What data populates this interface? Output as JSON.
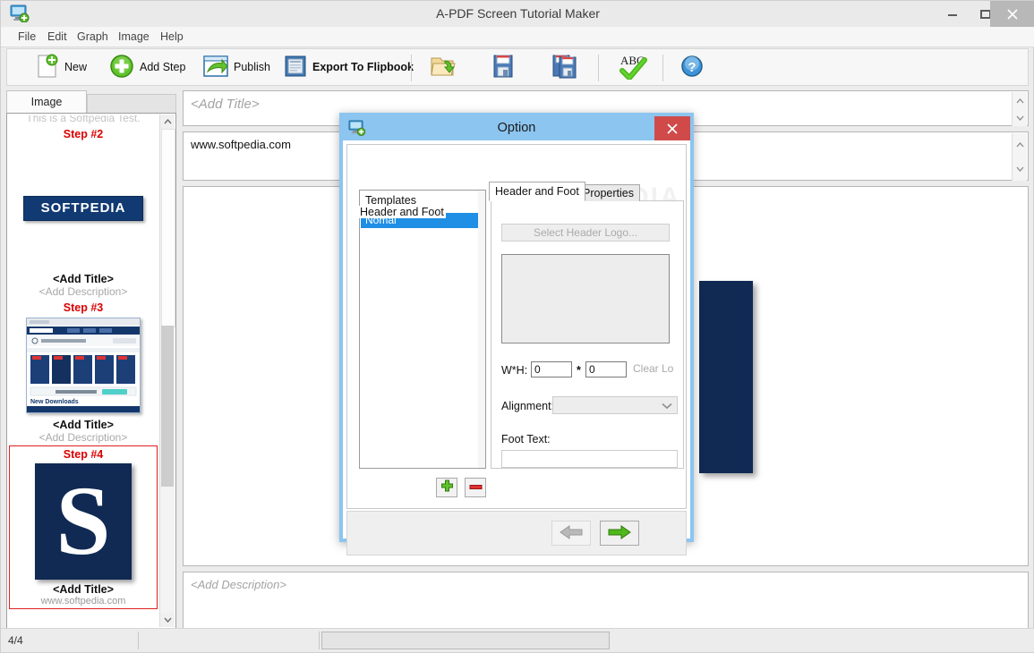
{
  "window": {
    "title": "A-PDF Screen Tutorial Maker",
    "icon": "monitor-add-icon",
    "controls": {
      "minimize": "minimize-icon",
      "maximize": "maximize-icon",
      "close": "close-icon"
    }
  },
  "menubar": {
    "items": [
      "File",
      "Edit",
      "Graph",
      "Image",
      "Help"
    ]
  },
  "toolbar": {
    "buttons": [
      {
        "label": "New",
        "icon": "new-document-icon",
        "bold": false
      },
      {
        "label": "Add Step",
        "icon": "green-plus-circle-icon",
        "bold": false
      },
      {
        "label": "Publish",
        "icon": "publish-window-arrow-icon",
        "bold": false
      },
      {
        "label": "Export To Flipbook",
        "icon": "book-icon",
        "bold": true
      },
      {
        "label": "",
        "icon": "open-folder-icon",
        "bold": false
      },
      {
        "label": "",
        "icon": "save-floppy-icon",
        "bold": false
      },
      {
        "label": "",
        "icon": "save-as-floppy-icon",
        "bold": false
      },
      {
        "label": "",
        "icon": "abc-spellcheck-icon",
        "bold": false
      },
      {
        "label": "",
        "icon": "help-question-icon",
        "bold": false
      }
    ]
  },
  "sidebar": {
    "tab_label": "Image",
    "thumbnails": [
      {
        "step": "",
        "top_text": "This is a Softpedia Test.",
        "title": "",
        "desc": "",
        "url": "",
        "art": "none",
        "selected": false
      },
      {
        "step": "Step #2",
        "top_text": "",
        "title": "<Add Title>",
        "desc": "<Add Description>",
        "url": "",
        "art": "softpedia-wordmark",
        "selected": false
      },
      {
        "step": "Step #3",
        "top_text": "",
        "title": "<Add Title>",
        "desc": "<Add Description>",
        "url": "",
        "art": "browser-screenshot",
        "selected": false
      },
      {
        "step": "Step #4",
        "top_text": "",
        "title": "<Add Title>",
        "desc": "",
        "url": "www.softpedia.com",
        "art": "s-logo",
        "selected": true
      }
    ],
    "logo_wordmark": "SOFTPEDIA"
  },
  "main": {
    "title_placeholder": "<Add Title>",
    "url_value": "www.softpedia.com",
    "description_placeholder": "<Add Description>"
  },
  "statusbar": {
    "page_indicator": "4/4",
    "cell2": "",
    "cell3": ""
  },
  "dialog": {
    "title": "Option",
    "icon": "monitor-add-icon",
    "close_icon": "close-icon",
    "templates": {
      "header": "Templates",
      "items": [
        "Nomal"
      ],
      "selected": "Nomal",
      "add_button": "add-template-icon",
      "remove_button": "remove-template-icon"
    },
    "tabs": [
      {
        "label": "Header and Foot",
        "active": true
      },
      {
        "label": "Properties",
        "active": false
      }
    ],
    "group_label": "Header and Foot",
    "select_logo_button": "Select Header Logo...",
    "wh_label": "W*H:",
    "wh_separator": "*",
    "width_value": "0",
    "height_value": "0",
    "clear_logo_button": "Clear Logo...",
    "alignment_label": "Alignment:",
    "alignment_value": "",
    "foot_text_label": "Foot Text:",
    "foot_text_value": "",
    "nav": {
      "back": "back-arrow-icon",
      "next": "next-arrow-icon"
    },
    "watermark": "SOFTPEDIA"
  },
  "colors": {
    "dialog_accent": "#8cc5f0",
    "close_red": "#d04a4a",
    "selection_blue": "#1f8fe5",
    "step_red": "#d90000",
    "logo_navy": "#102a54"
  }
}
